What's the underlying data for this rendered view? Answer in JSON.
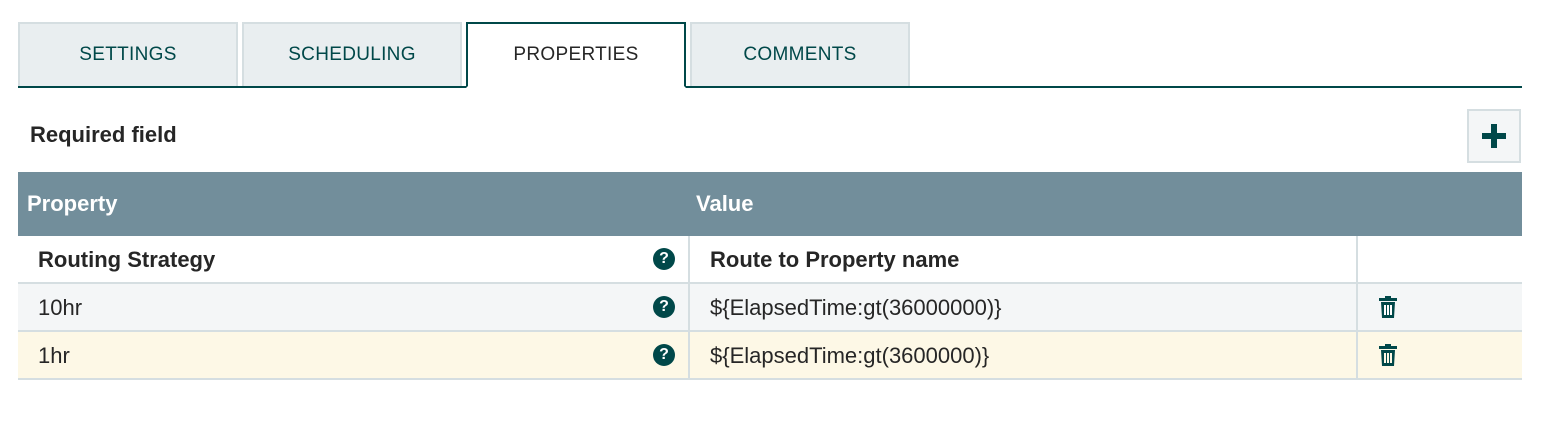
{
  "tabs": [
    {
      "label": "SETTINGS"
    },
    {
      "label": "SCHEDULING"
    },
    {
      "label": "PROPERTIES"
    },
    {
      "label": "COMMENTS"
    }
  ],
  "active_tab": "PROPERTIES",
  "section": {
    "required_label": "Required field",
    "add_icon": "plus-icon"
  },
  "table": {
    "headers": {
      "property": "Property",
      "value": "Value"
    },
    "rows": [
      {
        "property": "Routing Strategy",
        "value": "Route to Property name",
        "deletable": false
      },
      {
        "property": "10hr",
        "value": "${ElapsedTime:gt(36000000)}",
        "deletable": true
      },
      {
        "property": "1hr",
        "value": "${ElapsedTime:gt(3600000)}",
        "deletable": true
      }
    ],
    "help_icon": "question-circle-icon",
    "delete_icon": "trash-icon"
  },
  "colors": {
    "accent": "#004849",
    "header_bg": "#728e9b",
    "tab_bg": "#e9eef0",
    "highlight_row": "#fdf8e6"
  }
}
